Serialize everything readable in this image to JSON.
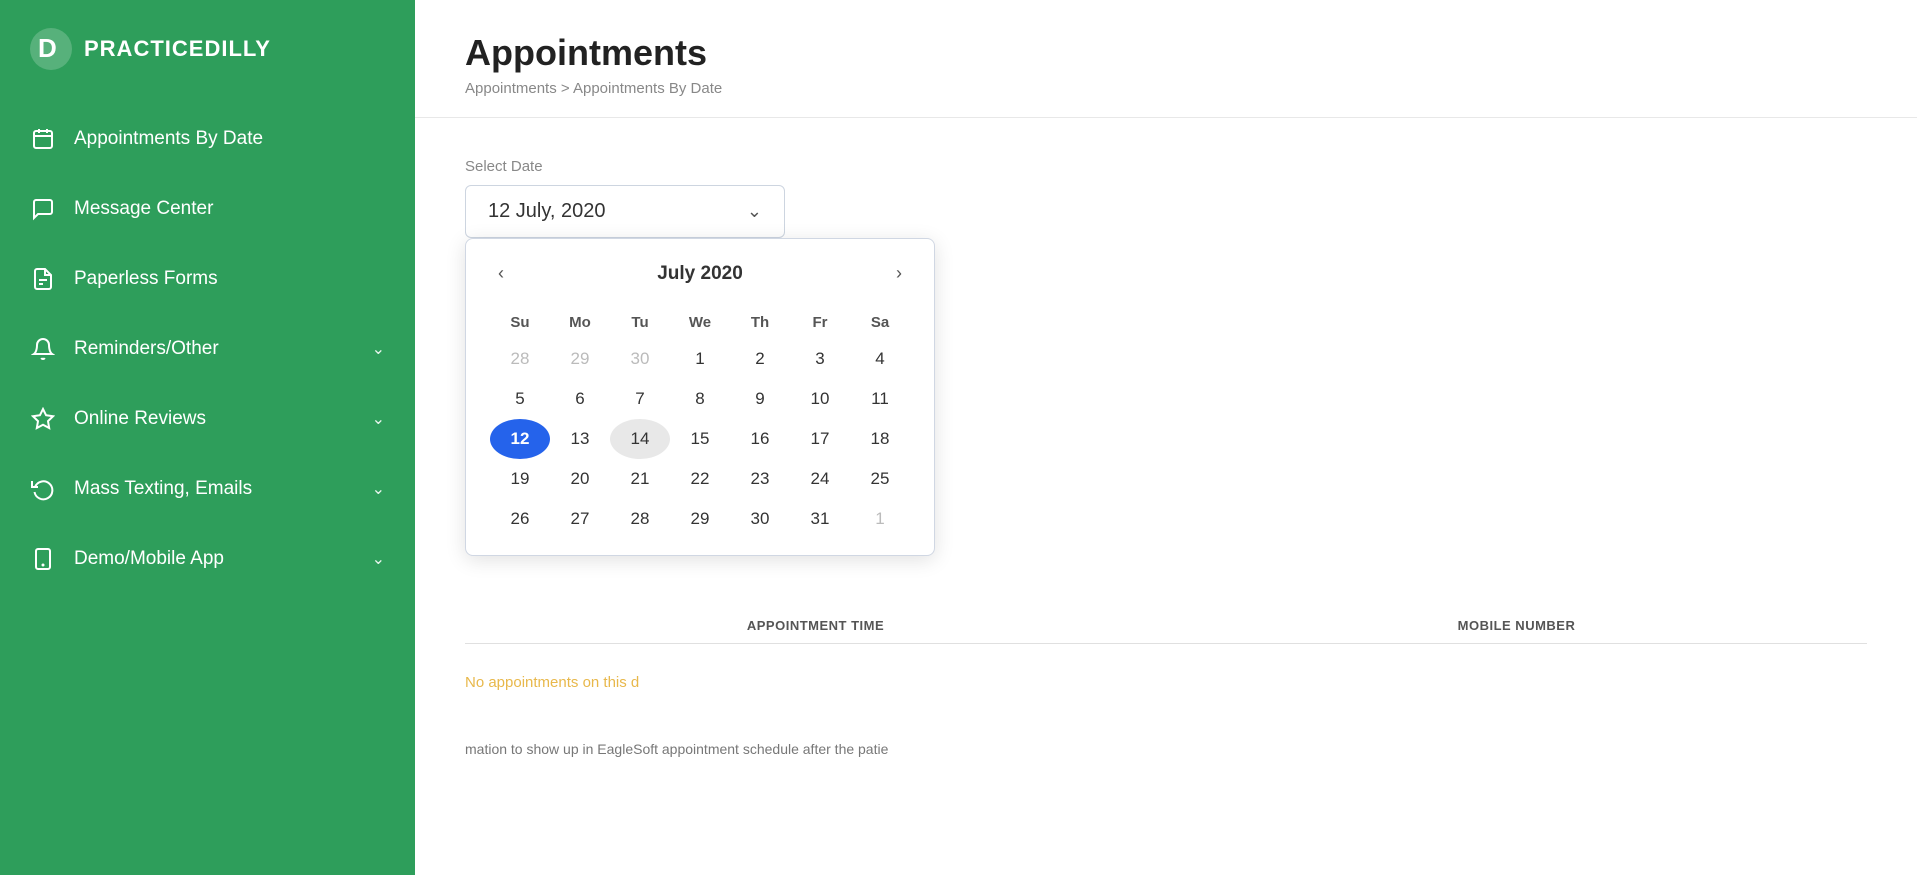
{
  "app": {
    "name": "PRACTICEDILLY"
  },
  "sidebar": {
    "items": [
      {
        "id": "appointments-by-date",
        "label": "Appointments By Date",
        "icon": "calendar",
        "expandable": false
      },
      {
        "id": "message-center",
        "label": "Message Center",
        "icon": "chat",
        "expandable": false
      },
      {
        "id": "paperless-forms",
        "label": "Paperless Forms",
        "icon": "document",
        "expandable": false
      },
      {
        "id": "reminders-other",
        "label": "Reminders/Other",
        "icon": "bell",
        "expandable": true
      },
      {
        "id": "online-reviews",
        "label": "Online Reviews",
        "icon": "star",
        "expandable": true
      },
      {
        "id": "mass-texting",
        "label": "Mass Texting, Emails",
        "icon": "refresh",
        "expandable": true
      },
      {
        "id": "demo-mobile",
        "label": "Demo/Mobile App",
        "icon": "phone",
        "expandable": true
      }
    ]
  },
  "page": {
    "title": "Appointments",
    "breadcrumb": "Appointments > Appointments By Date"
  },
  "datePicker": {
    "label": "Select Date",
    "selectedDate": "12 July, 2020"
  },
  "calendar": {
    "monthYear": "July 2020",
    "dayHeaders": [
      "Su",
      "Mo",
      "Tu",
      "We",
      "Th",
      "Fr",
      "Sa"
    ],
    "weeks": [
      [
        {
          "day": "28",
          "otherMonth": true
        },
        {
          "day": "29",
          "otherMonth": true
        },
        {
          "day": "30",
          "otherMonth": true
        },
        {
          "day": "1",
          "otherMonth": false
        },
        {
          "day": "2",
          "otherMonth": false
        },
        {
          "day": "3",
          "otherMonth": false
        },
        {
          "day": "4",
          "otherMonth": false
        }
      ],
      [
        {
          "day": "5",
          "otherMonth": false
        },
        {
          "day": "6",
          "otherMonth": false
        },
        {
          "day": "7",
          "otherMonth": false
        },
        {
          "day": "8",
          "otherMonth": false
        },
        {
          "day": "9",
          "otherMonth": false
        },
        {
          "day": "10",
          "otherMonth": false
        },
        {
          "day": "11",
          "otherMonth": false
        }
      ],
      [
        {
          "day": "12",
          "otherMonth": false,
          "selected": true
        },
        {
          "day": "13",
          "otherMonth": false
        },
        {
          "day": "14",
          "otherMonth": false,
          "hovered": true
        },
        {
          "day": "15",
          "otherMonth": false
        },
        {
          "day": "16",
          "otherMonth": false
        },
        {
          "day": "17",
          "otherMonth": false
        },
        {
          "day": "18",
          "otherMonth": false
        }
      ],
      [
        {
          "day": "19",
          "otherMonth": false
        },
        {
          "day": "20",
          "otherMonth": false
        },
        {
          "day": "21",
          "otherMonth": false
        },
        {
          "day": "22",
          "otherMonth": false
        },
        {
          "day": "23",
          "otherMonth": false
        },
        {
          "day": "24",
          "otherMonth": false
        },
        {
          "day": "25",
          "otherMonth": false
        }
      ],
      [
        {
          "day": "26",
          "otherMonth": false
        },
        {
          "day": "27",
          "otherMonth": false
        },
        {
          "day": "28",
          "otherMonth": false
        },
        {
          "day": "29",
          "otherMonth": false
        },
        {
          "day": "30",
          "otherMonth": false
        },
        {
          "day": "31",
          "otherMonth": false
        },
        {
          "day": "1",
          "otherMonth": true
        }
      ]
    ]
  },
  "table": {
    "col_appointment_time": "APPOINTMENT TIME",
    "col_mobile_number": "MOBILE NUMBER",
    "no_appointments_msg": "No appointments on this d",
    "footer_note": "mation to show up in EagleSoft appointment schedule after the patie"
  }
}
